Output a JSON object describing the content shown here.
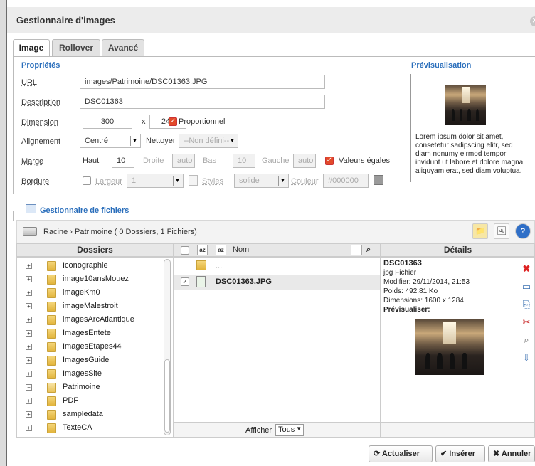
{
  "window": {
    "title": "Gestionnaire d'images",
    "close_icon": "close-icon"
  },
  "tabs": [
    {
      "label": "Image",
      "active": true
    },
    {
      "label": "Rollover"
    },
    {
      "label": "Avancé"
    }
  ],
  "properties": {
    "section": "Propriétés",
    "url": {
      "label": "URL",
      "value": "images/Patrimoine/DSC01363.JPG"
    },
    "description": {
      "label": "Description",
      "value": "DSC01363"
    },
    "dimension": {
      "label": "Dimension",
      "width": "300",
      "x": "x",
      "height": "241",
      "proportional": "Proportionnel"
    },
    "alignment": {
      "label": "Alignement",
      "value": "Centré",
      "clear_label": "Nettoyer",
      "clear_value": "--Non défini--"
    },
    "margin": {
      "label": "Marge",
      "top_label": "Haut",
      "top": "10",
      "right_label": "Droite",
      "right": "auto",
      "bottom_label": "Bas",
      "bottom": "10",
      "left_label": "Gauche",
      "left": "auto",
      "equal": "Valeurs égales"
    },
    "border": {
      "label": "Bordure",
      "width_label": "Largeur",
      "width": "1",
      "style_label": "Styles",
      "style": "solide",
      "color_label": "Couleur",
      "color": "#000000"
    }
  },
  "preview": {
    "section": "Prévisualisation",
    "lorem": "Lorem ipsum dolor sit amet, consetetur sadipscing elitr, sed diam nonumy eirmod tempor invidunt ut labore et dolore magna aliquyam erat, sed diam voluptua."
  },
  "file_manager": {
    "title": "Gestionnaire de fichiers",
    "path": "Racine › Patrimoine    ( 0 Dossiers, 1 Fichiers)",
    "folders_header": "Dossiers",
    "folders": [
      "Iconographie",
      "image10ansMouez",
      "imageKm0",
      "imageMalestroit",
      "imagesArcAtlantique",
      "ImagesEntete",
      "ImagesEtapes44",
      "ImagesGuide",
      "ImagesSite",
      "Patrimoine",
      "PDF",
      "sampledata",
      "TexteCA"
    ],
    "name_header": "Nom",
    "files": [
      {
        "name": "..."
      },
      {
        "name": "DSC01363.JPG"
      }
    ],
    "show_label": "Afficher",
    "show_value": "Tous",
    "details_header": "Détails",
    "details": {
      "name": "DSC01363",
      "type": "jpg Fichier",
      "modified": "Modifier: 29/11/2014, 21:53",
      "weight": "Poids: 492.81 Ko",
      "dimensions": "Dimensions: 1600 x 1284",
      "preview": "Prévisualiser:"
    }
  },
  "buttons": {
    "refresh": "Actualiser",
    "insert": "Insérer",
    "cancel": "Annuler"
  }
}
